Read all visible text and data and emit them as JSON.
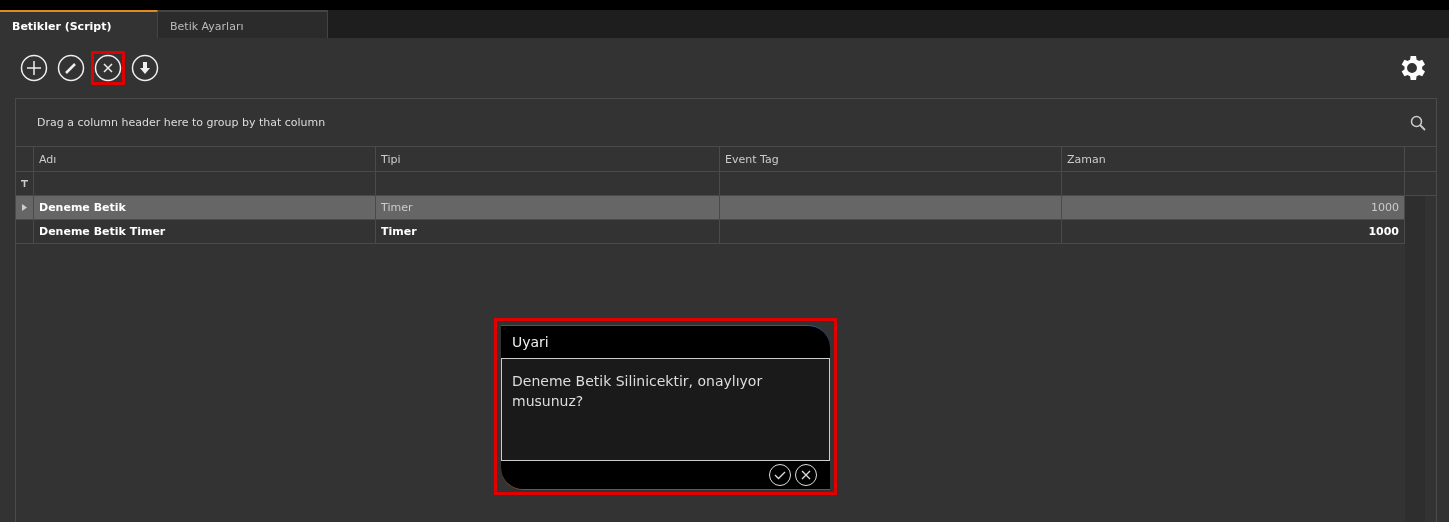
{
  "tabs": [
    {
      "label": "Betikler (Script)",
      "selected": true
    },
    {
      "label": "Betik Ayarları",
      "selected": false
    }
  ],
  "toolbar": [
    {
      "kind": "add",
      "highlighted": false
    },
    {
      "kind": "edit",
      "highlighted": false
    },
    {
      "kind": "delete",
      "highlighted": true
    },
    {
      "kind": "download",
      "highlighted": false
    }
  ],
  "grid": {
    "group_hint": "Drag a column header here to group by that column",
    "columns": [
      "Adı",
      "Tipi",
      "Event Tag",
      "Zaman"
    ],
    "rows": [
      {
        "selected": true,
        "cells": [
          "Deneme Betik",
          "Timer",
          "",
          "1000"
        ]
      },
      {
        "selected": false,
        "cells": [
          "Deneme Betik Timer",
          "Timer",
          "",
          "1000"
        ]
      }
    ]
  },
  "dialog": {
    "title": "Uyari",
    "message": "Deneme Betik Silinicektir, onaylıyor musunuz?",
    "highlighted": true
  }
}
